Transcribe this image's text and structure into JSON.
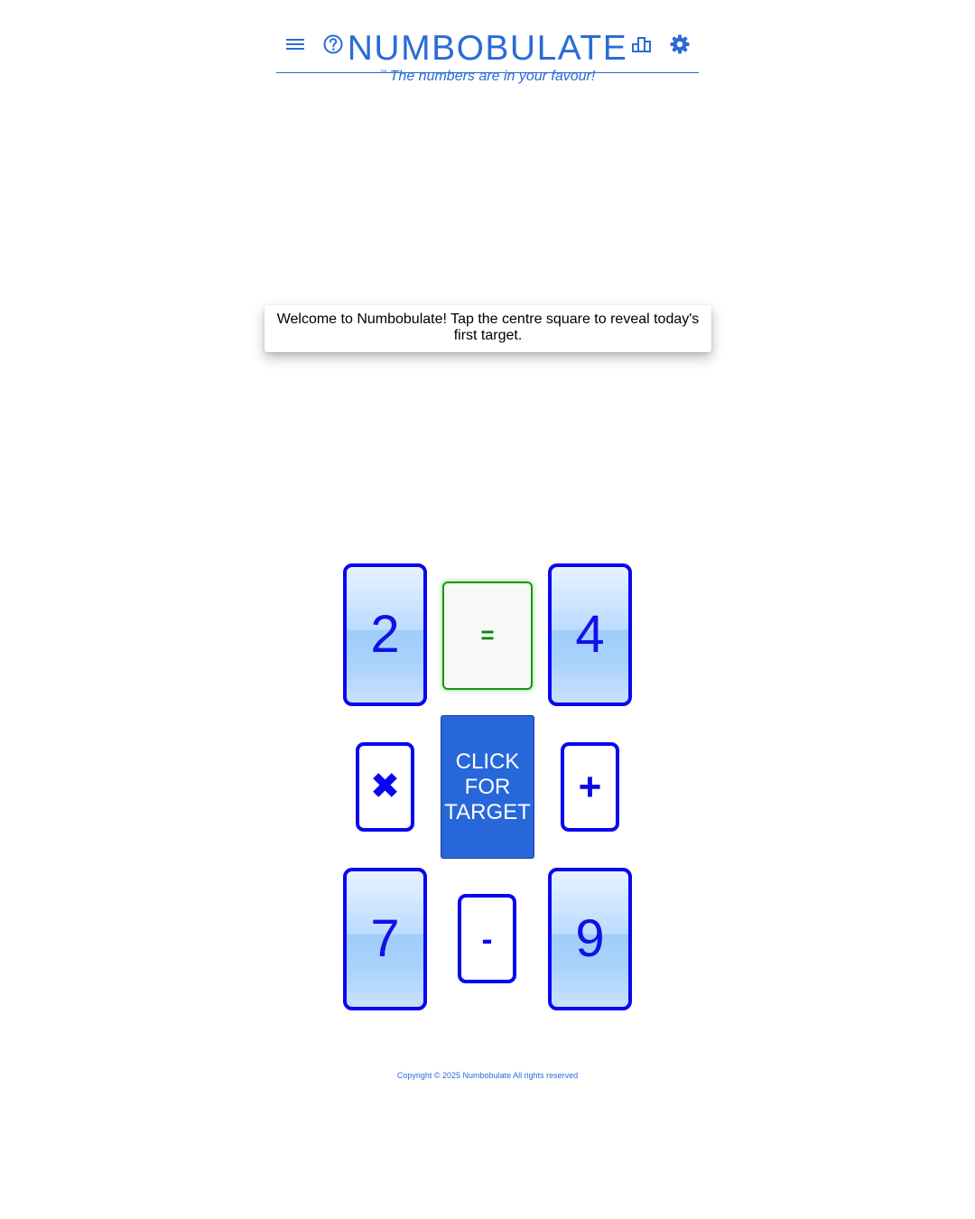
{
  "header": {
    "title": "NUMBOBULATE",
    "tagline_mark": "™",
    "tagline": "The numbers are in your favour!",
    "icons": {
      "menu": "hamburger-menu-icon",
      "help": "help-circle-icon",
      "stats": "leaderboard-icon",
      "settings": "gear-icon"
    }
  },
  "toast": {
    "message": "Welcome to Numbobulate! Tap the centre square to reveal today's first target."
  },
  "board": {
    "numbers": {
      "top_left": "2",
      "top_right": "4",
      "bottom_left": "7",
      "bottom_right": "9"
    },
    "operators": {
      "multiply": "✖",
      "add": "+",
      "subtract": "-",
      "equals": "="
    },
    "target_button": {
      "line1": "CLICK",
      "line2": "FOR",
      "line3": "TARGET"
    }
  },
  "footer": {
    "copyright": "Copyright © 2025 Numbobulate All rights reserved"
  },
  "colors": {
    "brand_blue": "#2a6bd6",
    "card_border": "#0a06f0",
    "target_bg": "#2767d9",
    "equals_green": "#129a12"
  }
}
